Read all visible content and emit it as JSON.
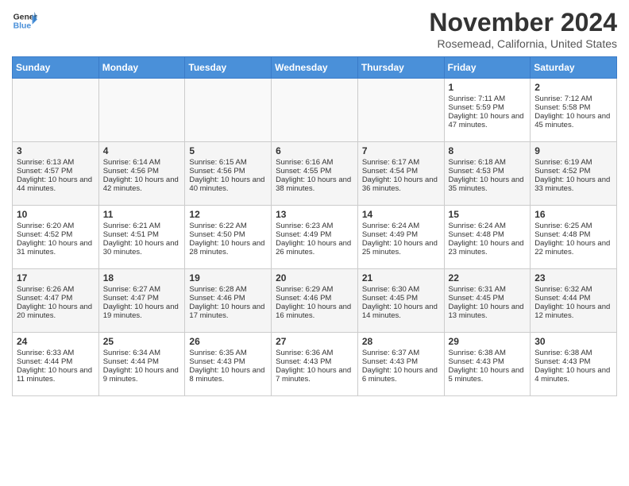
{
  "header": {
    "logo_line1": "General",
    "logo_line2": "Blue",
    "month": "November 2024",
    "location": "Rosemead, California, United States"
  },
  "days_of_week": [
    "Sunday",
    "Monday",
    "Tuesday",
    "Wednesday",
    "Thursday",
    "Friday",
    "Saturday"
  ],
  "weeks": [
    [
      {
        "day": "",
        "content": ""
      },
      {
        "day": "",
        "content": ""
      },
      {
        "day": "",
        "content": ""
      },
      {
        "day": "",
        "content": ""
      },
      {
        "day": "",
        "content": ""
      },
      {
        "day": "1",
        "content": "Sunrise: 7:11 AM\nSunset: 5:59 PM\nDaylight: 10 hours and 47 minutes."
      },
      {
        "day": "2",
        "content": "Sunrise: 7:12 AM\nSunset: 5:58 PM\nDaylight: 10 hours and 45 minutes."
      }
    ],
    [
      {
        "day": "3",
        "content": "Sunrise: 6:13 AM\nSunset: 4:57 PM\nDaylight: 10 hours and 44 minutes."
      },
      {
        "day": "4",
        "content": "Sunrise: 6:14 AM\nSunset: 4:56 PM\nDaylight: 10 hours and 42 minutes."
      },
      {
        "day": "5",
        "content": "Sunrise: 6:15 AM\nSunset: 4:56 PM\nDaylight: 10 hours and 40 minutes."
      },
      {
        "day": "6",
        "content": "Sunrise: 6:16 AM\nSunset: 4:55 PM\nDaylight: 10 hours and 38 minutes."
      },
      {
        "day": "7",
        "content": "Sunrise: 6:17 AM\nSunset: 4:54 PM\nDaylight: 10 hours and 36 minutes."
      },
      {
        "day": "8",
        "content": "Sunrise: 6:18 AM\nSunset: 4:53 PM\nDaylight: 10 hours and 35 minutes."
      },
      {
        "day": "9",
        "content": "Sunrise: 6:19 AM\nSunset: 4:52 PM\nDaylight: 10 hours and 33 minutes."
      }
    ],
    [
      {
        "day": "10",
        "content": "Sunrise: 6:20 AM\nSunset: 4:52 PM\nDaylight: 10 hours and 31 minutes."
      },
      {
        "day": "11",
        "content": "Sunrise: 6:21 AM\nSunset: 4:51 PM\nDaylight: 10 hours and 30 minutes."
      },
      {
        "day": "12",
        "content": "Sunrise: 6:22 AM\nSunset: 4:50 PM\nDaylight: 10 hours and 28 minutes."
      },
      {
        "day": "13",
        "content": "Sunrise: 6:23 AM\nSunset: 4:49 PM\nDaylight: 10 hours and 26 minutes."
      },
      {
        "day": "14",
        "content": "Sunrise: 6:24 AM\nSunset: 4:49 PM\nDaylight: 10 hours and 25 minutes."
      },
      {
        "day": "15",
        "content": "Sunrise: 6:24 AM\nSunset: 4:48 PM\nDaylight: 10 hours and 23 minutes."
      },
      {
        "day": "16",
        "content": "Sunrise: 6:25 AM\nSunset: 4:48 PM\nDaylight: 10 hours and 22 minutes."
      }
    ],
    [
      {
        "day": "17",
        "content": "Sunrise: 6:26 AM\nSunset: 4:47 PM\nDaylight: 10 hours and 20 minutes."
      },
      {
        "day": "18",
        "content": "Sunrise: 6:27 AM\nSunset: 4:47 PM\nDaylight: 10 hours and 19 minutes."
      },
      {
        "day": "19",
        "content": "Sunrise: 6:28 AM\nSunset: 4:46 PM\nDaylight: 10 hours and 17 minutes."
      },
      {
        "day": "20",
        "content": "Sunrise: 6:29 AM\nSunset: 4:46 PM\nDaylight: 10 hours and 16 minutes."
      },
      {
        "day": "21",
        "content": "Sunrise: 6:30 AM\nSunset: 4:45 PM\nDaylight: 10 hours and 14 minutes."
      },
      {
        "day": "22",
        "content": "Sunrise: 6:31 AM\nSunset: 4:45 PM\nDaylight: 10 hours and 13 minutes."
      },
      {
        "day": "23",
        "content": "Sunrise: 6:32 AM\nSunset: 4:44 PM\nDaylight: 10 hours and 12 minutes."
      }
    ],
    [
      {
        "day": "24",
        "content": "Sunrise: 6:33 AM\nSunset: 4:44 PM\nDaylight: 10 hours and 11 minutes."
      },
      {
        "day": "25",
        "content": "Sunrise: 6:34 AM\nSunset: 4:44 PM\nDaylight: 10 hours and 9 minutes."
      },
      {
        "day": "26",
        "content": "Sunrise: 6:35 AM\nSunset: 4:43 PM\nDaylight: 10 hours and 8 minutes."
      },
      {
        "day": "27",
        "content": "Sunrise: 6:36 AM\nSunset: 4:43 PM\nDaylight: 10 hours and 7 minutes."
      },
      {
        "day": "28",
        "content": "Sunrise: 6:37 AM\nSunset: 4:43 PM\nDaylight: 10 hours and 6 minutes."
      },
      {
        "day": "29",
        "content": "Sunrise: 6:38 AM\nSunset: 4:43 PM\nDaylight: 10 hours and 5 minutes."
      },
      {
        "day": "30",
        "content": "Sunrise: 6:38 AM\nSunset: 4:43 PM\nDaylight: 10 hours and 4 minutes."
      }
    ]
  ]
}
